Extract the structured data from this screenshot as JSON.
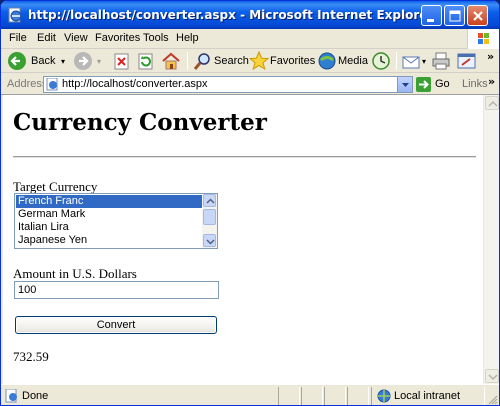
{
  "window": {
    "title": "http://localhost/converter.aspx - Microsoft Internet Explorer",
    "colors": {
      "title_bar": "#0a5fe8",
      "close_button": "#c9421d"
    }
  },
  "menu": {
    "items": [
      "File",
      "Edit",
      "View",
      "Favorites",
      "Tools",
      "Help"
    ]
  },
  "toolbar": {
    "back_label": "Back",
    "search_label": "Search",
    "favorites_label": "Favorites",
    "media_label": "Media",
    "icons": [
      "back-arrow-icon",
      "forward-arrow-icon",
      "stop-icon",
      "refresh-icon",
      "home-icon",
      "search-icon",
      "favorites-star-icon",
      "media-icon",
      "history-icon",
      "mail-icon",
      "print-icon",
      "edit-icon"
    ]
  },
  "address_bar": {
    "label": "Address",
    "url": "http://localhost/converter.aspx",
    "go_label": "Go",
    "links_label": "Links"
  },
  "page": {
    "title": "Currency Converter",
    "target_currency_label": "Target Currency",
    "currencies": [
      "French Franc",
      "German Mark",
      "Italian Lira",
      "Japanese Yen"
    ],
    "selected_currency": "French Franc",
    "amount_label": "Amount in U.S. Dollars",
    "amount_value": "100",
    "convert_label": "Convert",
    "result": "732.59",
    "colors": {
      "selection": "#316ac5"
    }
  },
  "status_bar": {
    "status_text": "Done",
    "zone_text": "Local intranet"
  }
}
